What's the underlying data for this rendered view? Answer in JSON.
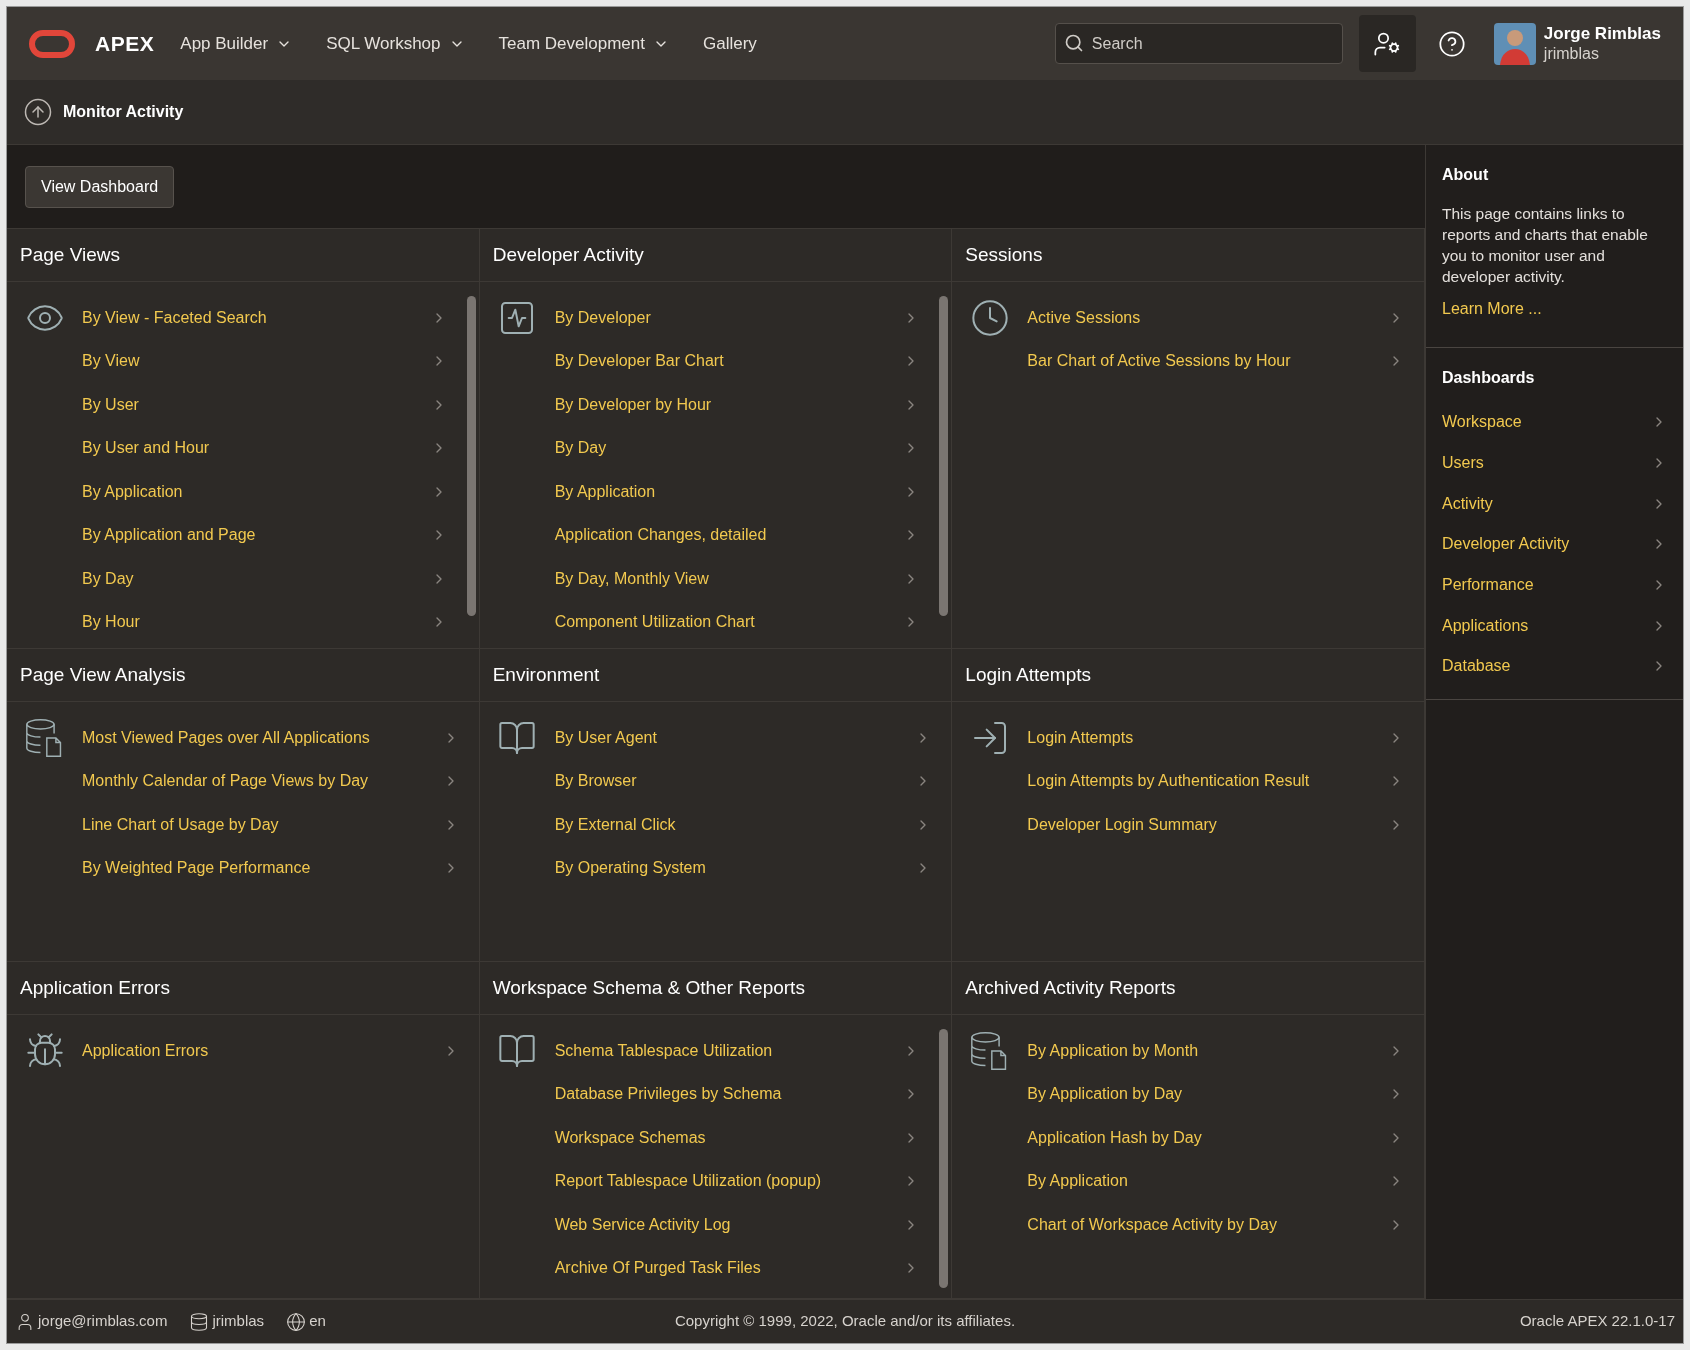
{
  "header": {
    "logo": "APEX",
    "nav": [
      {
        "label": "App Builder",
        "menu": true
      },
      {
        "label": "SQL Workshop",
        "menu": true
      },
      {
        "label": "Team Development",
        "menu": true
      },
      {
        "label": "Gallery",
        "menu": false
      }
    ],
    "search": {
      "placeholder": "Search"
    },
    "user": {
      "name": "Jorge Rimblas",
      "username": "jrimblas"
    }
  },
  "breadcrumb": "Monitor Activity",
  "toolbar": {
    "button": "View Dashboard"
  },
  "panels": [
    {
      "title": "Page Views",
      "scrollbar": true,
      "items": [
        "By View - Faceted Search",
        "By View",
        "By User",
        "By User and Hour",
        "By Application",
        "By Application and Page",
        "By Day",
        "By Hour"
      ]
    },
    {
      "title": "Developer Activity",
      "scrollbar": true,
      "items": [
        "By Developer",
        "By Developer Bar Chart",
        "By Developer by Hour",
        "By Day",
        "By Application",
        "Application Changes, detailed",
        "By Day, Monthly View",
        "Component Utilization Chart"
      ]
    },
    {
      "title": "Sessions",
      "scrollbar": false,
      "items": [
        "Active Sessions",
        "Bar Chart of Active Sessions by Hour"
      ]
    },
    {
      "title": "Page View Analysis",
      "scrollbar": false,
      "items": [
        "Most Viewed Pages over All Applications",
        "Monthly Calendar of Page Views by Day",
        "Line Chart of Usage by Day",
        "By Weighted Page Performance"
      ]
    },
    {
      "title": "Environment",
      "scrollbar": false,
      "items": [
        "By User Agent",
        "By Browser",
        "By External Click",
        "By Operating System"
      ]
    },
    {
      "title": "Login Attempts",
      "scrollbar": false,
      "items": [
        "Login Attempts",
        "Login Attempts by Authentication Result",
        "Developer Login Summary"
      ]
    },
    {
      "title": "Application Errors",
      "scrollbar": false,
      "items": [
        "Application Errors"
      ]
    },
    {
      "title": "Workspace Schema & Other Reports",
      "scrollbar": true,
      "items": [
        "Schema Tablespace Utilization",
        "Database Privileges by Schema",
        "Workspace Schemas",
        "Report Tablespace Utilization (popup)",
        "Web Service Activity Log",
        "Archive Of Purged Task Files"
      ]
    },
    {
      "title": "Archived Activity Reports",
      "scrollbar": false,
      "items": [
        "By Application by Month",
        "By Application by Day",
        "Application Hash by Day",
        "By Application",
        "Chart of Workspace Activity by Day"
      ]
    }
  ],
  "sidebar": {
    "about_title": "About",
    "about_text": "This page contains links to reports and charts that enable you to monitor user and developer activity.",
    "learn_more": "Learn More ...",
    "dashboards_title": "Dashboards",
    "dashboards": [
      "Workspace",
      "Users",
      "Activity",
      "Developer Activity",
      "Performance",
      "Applications",
      "Database"
    ]
  },
  "footer": {
    "email": "jorge@rimblas.com",
    "workspace": "jrimblas",
    "language": "en",
    "copyright": "Copyright © 1999, 2022, Oracle and/or its affiliates.",
    "version": "Oracle APEX 22.1.0-17"
  }
}
